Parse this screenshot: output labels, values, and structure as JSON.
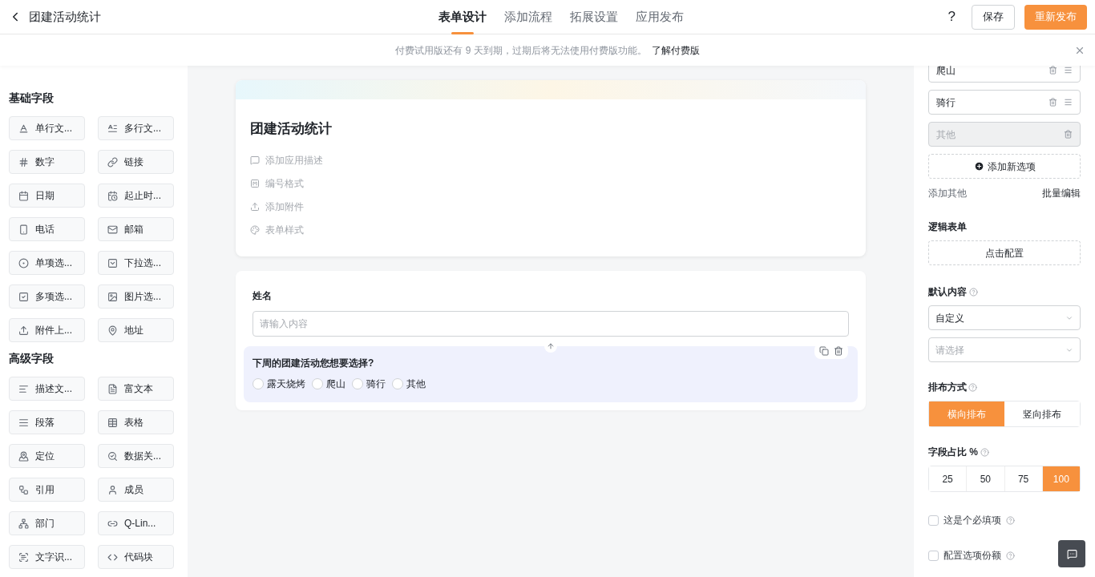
{
  "header": {
    "title": "团建活动统计",
    "tabs": [
      {
        "label": "表单设计",
        "selected": true
      },
      {
        "label": "添加流程",
        "selected": false
      },
      {
        "label": "拓展设置",
        "selected": false
      },
      {
        "label": "应用发布",
        "selected": false
      }
    ],
    "help": "?",
    "save": "保存",
    "publish": "重新发布"
  },
  "notice": {
    "text": "付费试用版还有 9 天到期，过期后将无法使用付费版功能。",
    "link": "了解付费版"
  },
  "sidebar": {
    "sections": [
      {
        "title": "基础字段",
        "items": [
          "单行文...",
          "多行文...",
          "数字",
          "链接",
          "日期",
          "起止时...",
          "电话",
          "邮箱",
          "单项选...",
          "下拉选...",
          "多项选...",
          "图片选...",
          "附件上...",
          "地址"
        ]
      },
      {
        "title": "高级字段",
        "items": [
          "描述文...",
          "富文本",
          "段落",
          "表格",
          "定位",
          "数据关...",
          "引用",
          "成员",
          "部门",
          "Q-Lin...",
          "文字识...",
          "代码块"
        ]
      }
    ]
  },
  "form": {
    "title": "团建活动统计",
    "meta": [
      "添加应用描述",
      "编号格式",
      "添加附件",
      "表单样式"
    ],
    "fields": [
      {
        "kind": "text",
        "label": "姓名",
        "placeholder": "请输入内容",
        "selected": false
      },
      {
        "kind": "radio",
        "label": "下周的团建活动您想要选择?",
        "options": [
          "露天烧烤",
          "爬山",
          "骑行",
          "其他"
        ],
        "selected": true
      }
    ]
  },
  "props": {
    "options": [
      {
        "kind": "option",
        "label": "爬山"
      },
      {
        "kind": "option",
        "label": "骑行"
      },
      {
        "kind": "other",
        "label": "其他"
      }
    ],
    "add_option": "添加新选项",
    "add_other": "添加其他",
    "batch_edit": "批量编辑",
    "logic_title": "逻辑表单",
    "logic_button": "点击配置",
    "default_title": "默认内容",
    "default_mode": "自定义",
    "default_placeholder": "请选择",
    "layout_title": "排布方式",
    "layouts": [
      {
        "label": "横向排布",
        "selected": true
      },
      {
        "label": "竖向排布",
        "selected": false
      }
    ],
    "width_title": "字段占比 %",
    "widths": [
      {
        "label": "25",
        "selected": false
      },
      {
        "label": "50",
        "selected": false
      },
      {
        "label": "75",
        "selected": false
      },
      {
        "label": "100",
        "selected": true
      }
    ],
    "checks": [
      {
        "label": "这是个必填项",
        "checked": false
      },
      {
        "label": "配置选项份额",
        "checked": false
      }
    ]
  }
}
